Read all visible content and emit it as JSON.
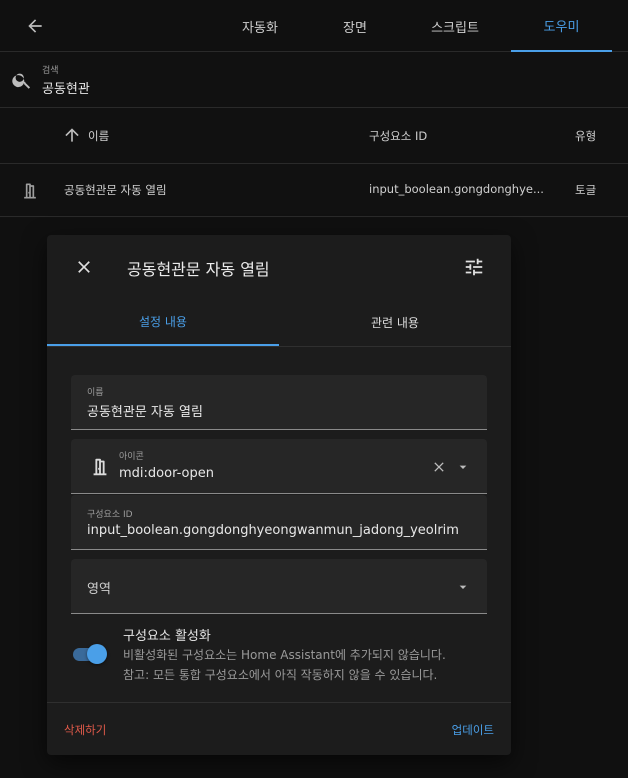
{
  "header": {
    "tabs": [
      {
        "label": "자동화"
      },
      {
        "label": "장면"
      },
      {
        "label": "스크립트"
      },
      {
        "label": "도우미"
      }
    ]
  },
  "search": {
    "label": "검색",
    "value": "공동현관"
  },
  "table": {
    "columns": {
      "name": "이름",
      "entity_id": "구성요소 ID",
      "type": "유형"
    },
    "rows": [
      {
        "name": "공동현관문 자동 열림",
        "entity_id": "input_boolean.gongdonghye...",
        "type": "토글"
      }
    ]
  },
  "dialog": {
    "title": "공동현관문 자동 열림",
    "tabs": [
      {
        "label": "설정 내용"
      },
      {
        "label": "관련 내용"
      }
    ],
    "name_field": {
      "label": "이름",
      "value": "공동현관문 자동 열림"
    },
    "icon_field": {
      "label": "아이콘",
      "value": "mdi:door-open"
    },
    "entity_id_field": {
      "label": "구성요소 ID",
      "value": "input_boolean.gongdonghyeongwanmun_jadong_yeolrim"
    },
    "area_field": {
      "label": "영역"
    },
    "enabled": {
      "title": "구성요소 활성화",
      "desc1": "비활성화된 구성요소는 Home Assistant에 추가되지 않습니다.",
      "desc2": "참고: 모든 통합 구성요소에서 아직 작동하지 않을 수 있습니다.",
      "on": true
    },
    "delete_label": "삭제하기",
    "update_label": "업데이트"
  },
  "colors": {
    "accent": "#4a9fe8",
    "danger": "#e05a4a",
    "background": "#111111",
    "dialog": "#1c1c1c"
  }
}
